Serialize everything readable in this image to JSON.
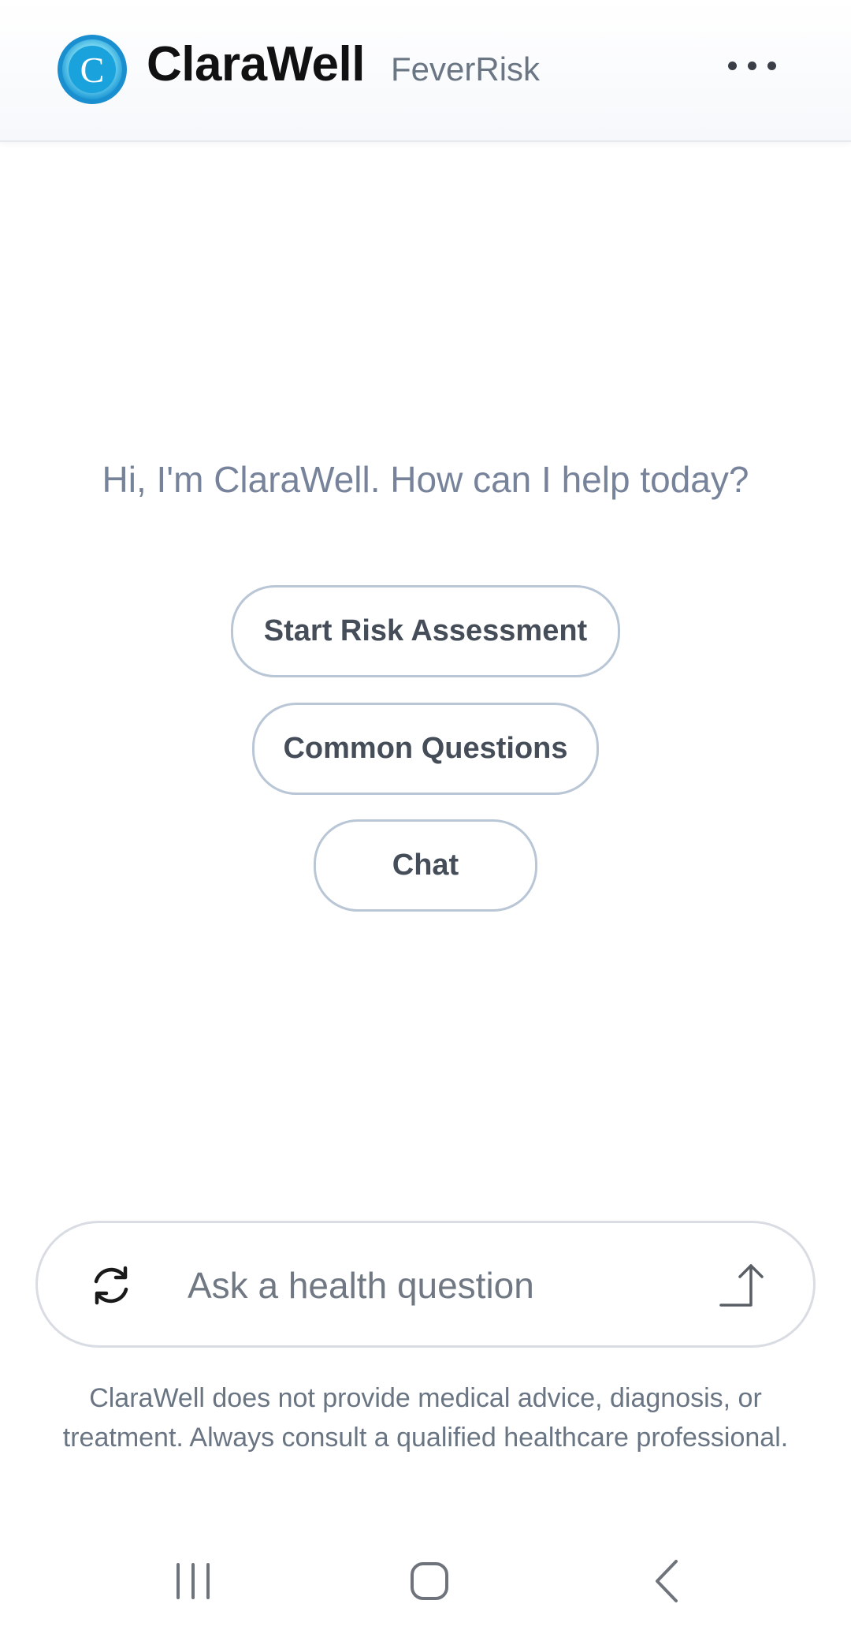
{
  "header": {
    "brand_name": "ClaraWell",
    "product_name": "FeverRisk",
    "logo_letter": "C",
    "menu_icon": "more-horizontal-icon"
  },
  "main": {
    "greeting": "Hi, I'm ClaraWell. How can I help today?",
    "actions": [
      {
        "label": "Start Risk Assessment"
      },
      {
        "label": "Common Questions"
      },
      {
        "label": "Chat"
      }
    ]
  },
  "composer": {
    "placeholder": "Ask a health question",
    "reset_icon": "refresh-icon",
    "send_icon": "send-arrow-icon"
  },
  "disclaimer": "ClaraWell does not provide medical advice, diagnosis, or treatment. Always consult a qualified healthcare professional.",
  "system_nav": {
    "recent_icon": "recent-apps-icon",
    "home_icon": "home-icon",
    "back_icon": "back-icon"
  },
  "colors": {
    "logo_blue": "#1e9ad6",
    "logo_cyan": "#5fd3f0",
    "button_border": "#b9c6d6",
    "greeting_text": "#76839a"
  }
}
